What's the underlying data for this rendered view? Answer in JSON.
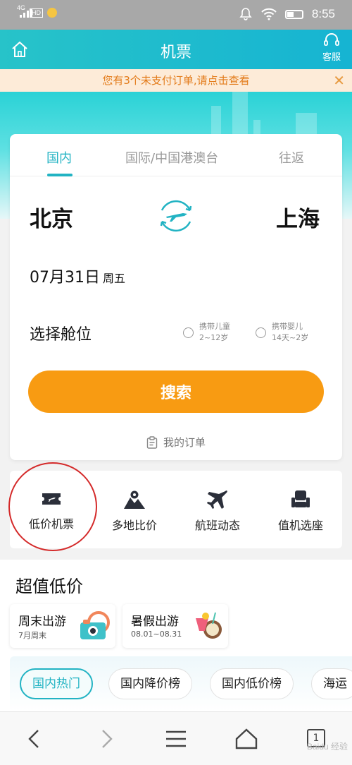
{
  "status_bar": {
    "network": "4G",
    "hd": "HD",
    "time": "8:55"
  },
  "header": {
    "title": "机票",
    "service_label": "客服"
  },
  "notice": {
    "text": "您有3个未支付订单,请点击查看",
    "close": "✕"
  },
  "booking": {
    "tabs": [
      {
        "label": "国内",
        "active": true
      },
      {
        "label": "国际/中国港澳台",
        "active": false
      },
      {
        "label": "往返",
        "active": false
      }
    ],
    "from_city": "北京",
    "to_city": "上海",
    "date": "07月31日",
    "weekday": "周五",
    "cabin_label": "选择舱位",
    "child_option": {
      "title": "携带儿童",
      "range": "2~12岁"
    },
    "infant_option": {
      "title": "携带婴儿",
      "range": "14天~2岁"
    },
    "search_label": "搜索",
    "my_orders_label": "我的订单"
  },
  "quick_entries": [
    {
      "label": "低价机票",
      "icon": "ticket-icon"
    },
    {
      "label": "多地比价",
      "icon": "map-pin-icon"
    },
    {
      "label": "航班动态",
      "icon": "plane-icon"
    },
    {
      "label": "值机选座",
      "icon": "seat-icon"
    }
  ],
  "deals": {
    "title": "超值低价",
    "cards": [
      {
        "title": "周末出游",
        "subtitle": "7月周末"
      },
      {
        "title": "暑假出游",
        "subtitle": "08.01~08.31"
      }
    ],
    "pills": [
      {
        "label": "国内热门",
        "active": true
      },
      {
        "label": "国内降价榜",
        "active": false
      },
      {
        "label": "国内低价榜",
        "active": false
      },
      {
        "label": "海运",
        "active": false
      }
    ]
  },
  "bottom_nav": {
    "tab_count": "1",
    "watermark": "Baidu 经验"
  },
  "colors": {
    "teal": "#22b3c3",
    "orange": "#f89b12",
    "notice_text": "#e37b1a",
    "highlight_circle": "#d42a2a"
  }
}
